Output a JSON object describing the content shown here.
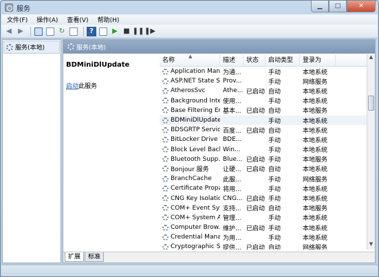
{
  "window": {
    "title": "服务"
  },
  "menu": [
    "文件(F)",
    "操作(A)",
    "查看(V)",
    "帮助(H)"
  ],
  "toolbar": {
    "icons": [
      "back-arrow-icon",
      "forward-arrow-icon",
      "console-tree-icon",
      "properties-icon",
      "refresh-icon",
      "export-icon",
      "help-icon",
      "view-icon",
      "play-icon",
      "stop-icon",
      "pause-icon",
      "restart-icon"
    ]
  },
  "tree": {
    "item": "服务(本地)"
  },
  "pane": {
    "header": "服务(本地)"
  },
  "selected_service": {
    "name": "BDMiniDlUpdate",
    "start_link": "启动",
    "start_suffix": "此服务"
  },
  "columns": [
    "名称",
    "描述",
    "状态",
    "启动类型",
    "登录为"
  ],
  "services": [
    {
      "name": "Application Man...",
      "desc": "为通...",
      "status": "",
      "type": "手动",
      "logon": "本地系统"
    },
    {
      "name": "ASP.NET State S...",
      "desc": "Prov...",
      "status": "",
      "type": "手动",
      "logon": "网络服务"
    },
    {
      "name": "AtherosSvc",
      "desc": "Athe...",
      "status": "已启动",
      "type": "自动",
      "logon": "本地系统"
    },
    {
      "name": "Background Inte...",
      "desc": "使用...",
      "status": "",
      "type": "手动",
      "logon": "本地系统"
    },
    {
      "name": "Base Filtering En...",
      "desc": "基本...",
      "status": "已启动",
      "type": "自动",
      "logon": "本地服务"
    },
    {
      "name": "BDMiniDlUpdate",
      "desc": "",
      "status": "",
      "type": "手动",
      "logon": "本地系统"
    },
    {
      "name": "BDSGRTP Service",
      "desc": "百度...",
      "status": "已启动",
      "type": "自动",
      "logon": "本地系统"
    },
    {
      "name": "BitLocker Drive ...",
      "desc": "BDE...",
      "status": "",
      "type": "手动",
      "logon": "本地系统"
    },
    {
      "name": "Block Level Back...",
      "desc": "Win...",
      "status": "",
      "type": "手动",
      "logon": "本地系统"
    },
    {
      "name": "Bluetooth Supp...",
      "desc": "Blue...",
      "status": "已启动",
      "type": "手动",
      "logon": "本地服务"
    },
    {
      "name": "Bonjour 服务",
      "desc": "让硬...",
      "status": "已启动",
      "type": "自动",
      "logon": "本地系统"
    },
    {
      "name": "BranchCache",
      "desc": "此服...",
      "status": "",
      "type": "手动",
      "logon": "网络服务"
    },
    {
      "name": "Certificate Propa...",
      "desc": "将用...",
      "status": "",
      "type": "手动",
      "logon": "本地系统"
    },
    {
      "name": "CNG Key Isolation",
      "desc": "CNG...",
      "status": "已启动",
      "type": "手动",
      "logon": "本地系统"
    },
    {
      "name": "COM+ Event Sys...",
      "desc": "支持...",
      "status": "已启动",
      "type": "自动",
      "logon": "本地服务"
    },
    {
      "name": "COM+ System A...",
      "desc": "管理...",
      "status": "",
      "type": "手动",
      "logon": "本地系统"
    },
    {
      "name": "Computer Brow...",
      "desc": "维护...",
      "status": "已启动",
      "type": "手动",
      "logon": "本地系统"
    },
    {
      "name": "Credential Mana...",
      "desc": "为用...",
      "status": "",
      "type": "手动",
      "logon": "本地系统"
    },
    {
      "name": "Cryptographic S...",
      "desc": "提供...",
      "status": "已启动",
      "type": "自动",
      "logon": "网络服务"
    }
  ],
  "tabs": [
    "扩展",
    "标准"
  ]
}
